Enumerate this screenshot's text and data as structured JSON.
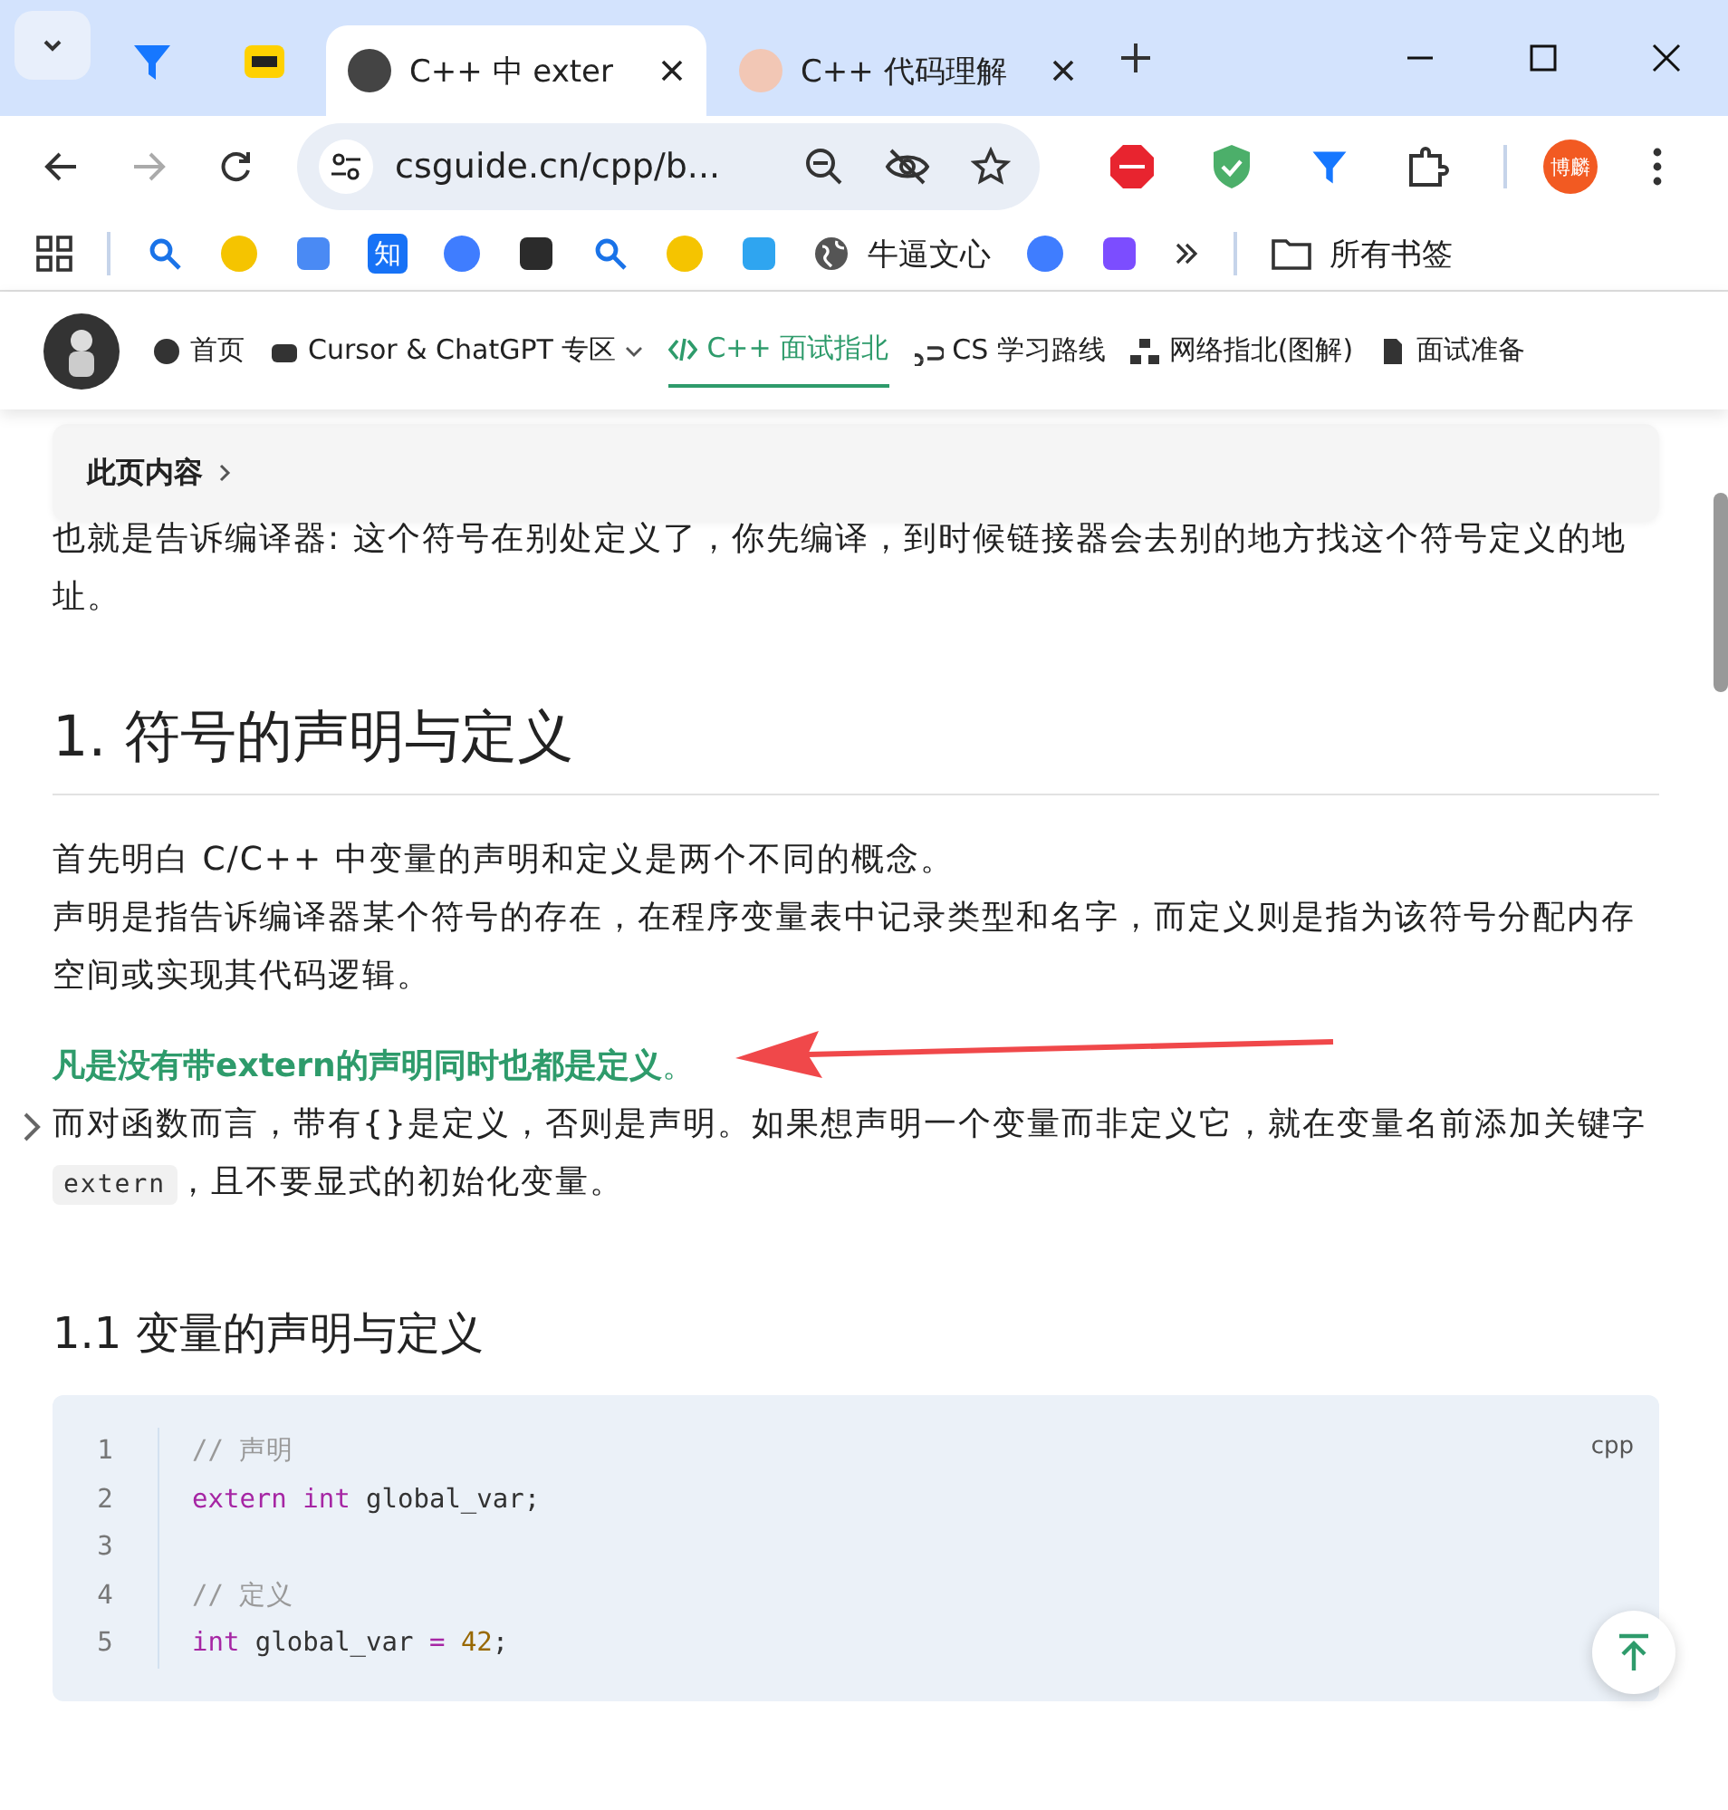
{
  "tabs": [
    {
      "kind": "icon",
      "selected": false
    },
    {
      "kind": "icon",
      "selected": false
    },
    {
      "kind": "page",
      "title": "C++ 中 exter",
      "selected": true
    },
    {
      "kind": "page",
      "title": "C++ 代码理解",
      "selected": false
    }
  ],
  "address": "csguide.cn/cpp/b...",
  "profile": "博麟",
  "bookmarks": [
    {
      "kind": "icon"
    },
    {
      "kind": "icon"
    },
    {
      "kind": "icon"
    },
    {
      "kind": "zhi",
      "label": "知"
    },
    {
      "kind": "icon"
    },
    {
      "kind": "icon"
    },
    {
      "kind": "icon"
    },
    {
      "kind": "icon"
    },
    {
      "kind": "icon"
    },
    {
      "kind": "globe",
      "label": "牛逼文心"
    },
    {
      "kind": "icon"
    },
    {
      "kind": "icon"
    }
  ],
  "all_bookmarks": "所有书签",
  "nav": [
    {
      "label": "首页",
      "selected": false,
      "dropdown": false
    },
    {
      "label": "Cursor & ChatGPT 专区",
      "selected": false,
      "dropdown": true
    },
    {
      "label": "C++ 面试指北",
      "selected": true,
      "dropdown": false
    },
    {
      "label": "CS 学习路线",
      "selected": false,
      "dropdown": false
    },
    {
      "label": "网络指北(图解)",
      "selected": false,
      "dropdown": false
    },
    {
      "label": "面试准备",
      "selected": false,
      "dropdown": false
    }
  ],
  "toc": "此页内容",
  "intro": "也就是告诉编译器: 这个符号在别处定义了，你先编译，到时候链接器会去别的地方找这个符号定义的地址。",
  "heading": "1. 符号的声明与定义",
  "paragraphs": [
    "首先明白 C/C++ 中变量的声明和定义是两个不同的概念。",
    "声明是指告诉编译器某个符号的存在，在程序变量表中记录类型和名字，而定义则是指为该符号分配内存空间或实现其代码逻辑。"
  ],
  "highlight": "凡是没有带extern的声明同时也都是定义",
  "highlight_end": "。",
  "para2_before": "而对函数而言，带有{}是定义，否则是声明。如果想声明一个变量而非定义它，就在变量名前添加关键字",
  "para2_code": "extern",
  "para2_after": "，且不要显式的初始化变量。",
  "subheading": "1.1 变量的声明与定义",
  "code": {
    "lang": "cpp",
    "lines": [
      {
        "num": "1",
        "tokens": [
          {
            "kind": "comment",
            "text": "// 声明"
          }
        ]
      },
      {
        "num": "2",
        "tokens": [
          {
            "kind": "keyword",
            "text": "extern int"
          },
          {
            "kind": "plain",
            "text": " global_var;"
          }
        ]
      },
      {
        "num": "3"
      },
      {
        "num": "4",
        "tokens": [
          {
            "kind": "comment",
            "text": "// 定义"
          }
        ]
      },
      {
        "num": "5",
        "tokens": [
          {
            "kind": "keyword",
            "text": "int"
          },
          {
            "kind": "plain",
            "text": " global_var "
          },
          {
            "kind": "keyword",
            "text": "= "
          },
          {
            "kind": "number",
            "text": "42"
          },
          {
            "kind": "plain",
            "text": ";"
          }
        ]
      }
    ]
  }
}
